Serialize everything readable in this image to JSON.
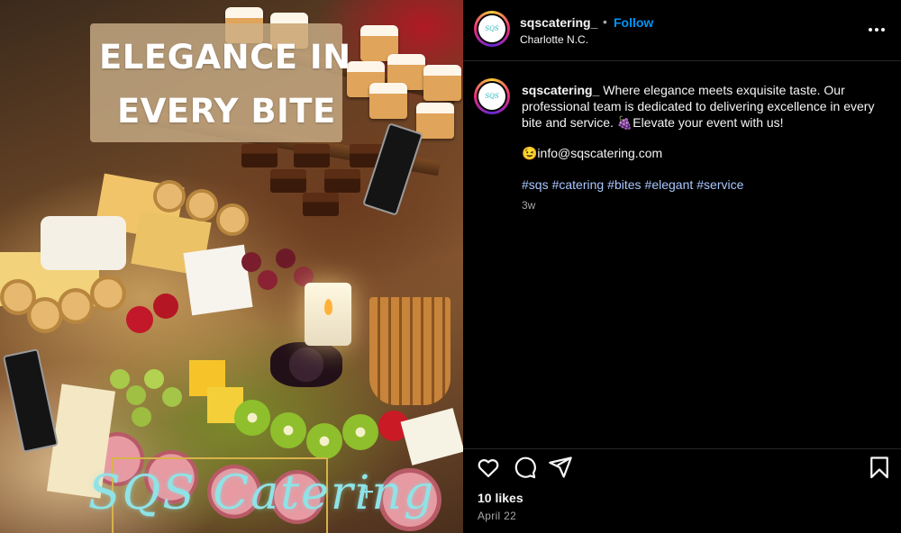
{
  "post_image": {
    "overlay_title_line1": "ELEGANCE IN",
    "overlay_title_line2": "EVERY BITE",
    "brand_text": "SQS Catering"
  },
  "header": {
    "username": "sqscatering_",
    "separator": "•",
    "follow_label": "Follow",
    "location": "Charlotte N.C."
  },
  "caption": {
    "username": "sqscatering_",
    "text": "Where elegance meets exquisite taste. Our professional team is dedicated to delivering excellence in every bite and service. 🍇Elevate your event with us!",
    "email_line": "😉info@sqscatering.com",
    "hashtags": [
      "#sqs",
      "#catering",
      "#bites",
      "#elegant",
      "#service"
    ],
    "age": "3w"
  },
  "footer": {
    "likes": "10 likes",
    "date": "April 22"
  },
  "colors": {
    "follow": "#0095f6",
    "hashtag": "#a9c7ff",
    "muted": "#a8a8a8",
    "background": "#000000"
  },
  "icons": [
    "more-options-icon",
    "heart-icon",
    "comment-icon",
    "share-icon",
    "bookmark-icon"
  ]
}
